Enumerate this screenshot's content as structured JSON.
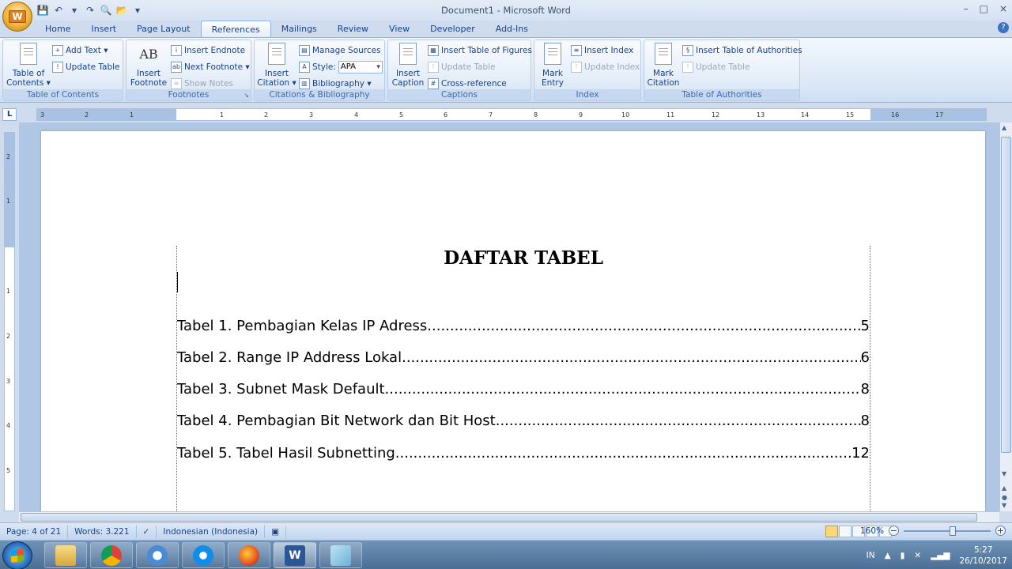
{
  "window": {
    "title": "Document1 - Microsoft Word",
    "minimize": "–",
    "maximize": "□",
    "close": "×"
  },
  "office_button": {
    "label": "W"
  },
  "quick_access": [
    {
      "icon": "save-icon",
      "glyph": "💾"
    },
    {
      "icon": "undo-icon",
      "glyph": "↶"
    },
    {
      "icon": "dropdown-icon",
      "glyph": "▾"
    },
    {
      "icon": "redo-icon",
      "glyph": "↷"
    },
    {
      "icon": "print-preview-icon",
      "glyph": "🔍"
    },
    {
      "icon": "open-icon",
      "glyph": "📂"
    },
    {
      "icon": "customize-icon",
      "glyph": "▾"
    }
  ],
  "tabs": [
    "Home",
    "Insert",
    "Page Layout",
    "References",
    "Mailings",
    "Review",
    "View",
    "Developer",
    "Add-Ins"
  ],
  "active_tab": "References",
  "help": "?",
  "ribbon": {
    "toc_group": {
      "label": "Table of Contents",
      "big_button": "Table of Contents",
      "big_button_line1": "Table of",
      "big_button_line2": "Contents ▾",
      "add_text": "Add Text ▾",
      "update_table": "Update Table"
    },
    "footnotes_group": {
      "label": "Footnotes",
      "insert_footnote_line1": "Insert",
      "insert_footnote_line2": "Footnote",
      "insert_endnote": "Insert Endnote",
      "next_footnote": "Next Footnote ▾",
      "show_notes": "Show Notes",
      "icon_text": "AB"
    },
    "citations_group": {
      "label": "Citations & Bibliography",
      "insert_citation_line1": "Insert",
      "insert_citation_line2": "Citation ▾",
      "manage_sources": "Manage Sources",
      "style_label": "Style:",
      "style_value": "APA",
      "bibliography": "Bibliography ▾"
    },
    "captions_group": {
      "label": "Captions",
      "insert_caption_line1": "Insert",
      "insert_caption_line2": "Caption",
      "insert_tof": "Insert Table of Figures",
      "update_table": "Update Table",
      "cross_reference": "Cross-reference"
    },
    "index_group": {
      "label": "Index",
      "mark_entry_line1": "Mark",
      "mark_entry_line2": "Entry",
      "insert_index": "Insert Index",
      "update_index": "Update Index"
    },
    "toa_group": {
      "label": "Table of Authorities",
      "mark_citation_line1": "Mark",
      "mark_citation_line2": "Citation",
      "insert_toa": "Insert Table of Authorities",
      "update_table": "Update Table"
    }
  },
  "ruler": {
    "corner": "L",
    "ticks": [
      "3",
      "2",
      "1",
      "1",
      "2",
      "3",
      "4",
      "5",
      "6",
      "7",
      "8",
      "9",
      "10",
      "11",
      "12",
      "13",
      "14",
      "15",
      "16",
      "17"
    ],
    "vticks": [
      "2",
      "1",
      "1",
      "2",
      "3",
      "4",
      "5"
    ]
  },
  "document": {
    "title": "DAFTAR TABEL",
    "entries": [
      {
        "label": "Tabel 1. Pembagian Kelas IP Adress",
        "page": "5"
      },
      {
        "label": "Tabel 2. Range IP Address Lokal",
        "page": "6"
      },
      {
        "label": "Tabel 3. Subnet Mask Default ",
        "page": "8"
      },
      {
        "label": "Tabel 4. Pembagian Bit Network dan Bit Host ",
        "page": "8"
      },
      {
        "label": "Tabel 5. Tabel Hasil Subnetting",
        "page": "12"
      }
    ]
  },
  "status": {
    "page": "Page: 4 of 21",
    "words": "Words: 3.221",
    "language": "Indonesian (Indonesia)",
    "zoom": "160%",
    "zoom_minus": "−",
    "zoom_plus": "+"
  },
  "taskbar": {
    "apps": [
      "explorer-icon",
      "chrome-icon",
      "chrome-alt-icon",
      "teamviewer-icon",
      "firefox-icon",
      "word-icon",
      "app-icon"
    ],
    "active_app": "word-icon"
  },
  "tray": {
    "lang": "IN",
    "show_hidden": "▲",
    "time": "5:27",
    "date": "26/10/2017"
  },
  "colors": {
    "accent": "#15428b",
    "ribbon_bg": "#dbe7f6",
    "taskbar": "#4c6f96",
    "active_view": "#fbd77b"
  }
}
